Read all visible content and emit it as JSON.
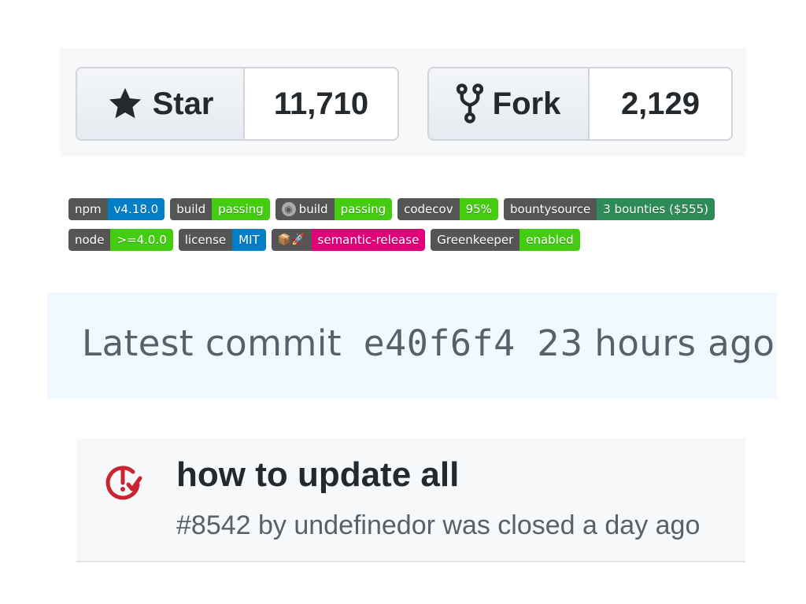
{
  "social": {
    "star": {
      "label": "Star",
      "count": "11,710",
      "icon": "star-icon"
    },
    "fork": {
      "label": "Fork",
      "count": "2,129",
      "icon": "fork-icon"
    }
  },
  "badges": {
    "row1": [
      {
        "label": "npm",
        "value": "v4.18.0",
        "color": "#007ec6"
      },
      {
        "label": "build",
        "value": "passing",
        "color": "#4c1"
      },
      {
        "label": "build",
        "value": "passing",
        "color": "#4c1",
        "icon": "circleci-icon"
      },
      {
        "label": "codecov",
        "value": "95%",
        "color": "#4c1"
      },
      {
        "label": "bountysource",
        "value": "3 bounties ($555)",
        "color": "#2e8b57"
      }
    ],
    "row2": [
      {
        "label": "node",
        "value": ">=4.0.0",
        "color": "#4c1"
      },
      {
        "label": "license",
        "value": "MIT",
        "color": "#007ec6"
      },
      {
        "label": "",
        "value": "semantic-release",
        "color": "#e10079",
        "icon": "package-rocket-icon"
      },
      {
        "label": "Greenkeeper",
        "value": "enabled",
        "color": "#4c1"
      }
    ]
  },
  "commit": {
    "label": "Latest commit",
    "sha": "e40f6f4",
    "when": "23 hours ago"
  },
  "issue": {
    "title": "how to update all",
    "meta": "#8542 by undefinedor was closed a day ago",
    "icon": "issue-closed-icon",
    "icon_color": "#cb2431"
  }
}
